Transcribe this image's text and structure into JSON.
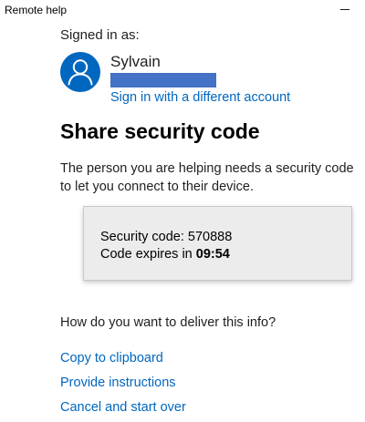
{
  "window": {
    "title": "Remote help",
    "minimize_icon": "minimize-icon"
  },
  "account": {
    "signed_in_label": "Signed in as:",
    "user_name": "Sylvain",
    "switch_account_link": "Sign in with a different account",
    "avatar_icon": "person-icon",
    "avatar_color": "#0067c0",
    "redaction_color": "#4472c4"
  },
  "main": {
    "heading": "Share security code",
    "description": "The person you are helping needs a security code to let you connect to their device.",
    "code_panel": {
      "code_label": "Security code: ",
      "code_value": "570888",
      "expires_label": "Code expires in ",
      "expires_value": "09:54"
    },
    "deliver_question": "How do you want to deliver this info?",
    "options": [
      "Copy to clipboard",
      "Provide instructions",
      "Cancel and start over"
    ]
  },
  "colors": {
    "link": "#0067c0",
    "panel_background": "#ececec"
  }
}
